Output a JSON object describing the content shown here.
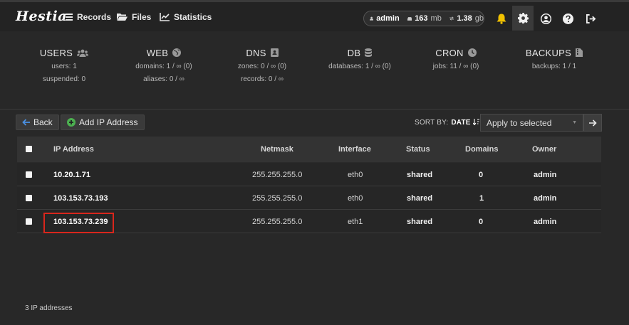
{
  "app": {
    "logo_text": "Hestia"
  },
  "nav": {
    "records": "Records",
    "files": "Files",
    "statistics": "Statistics"
  },
  "user_panel": {
    "username": "admin",
    "disk_value": "163",
    "disk_unit": "mb",
    "bandwidth_value": "1.38",
    "bandwidth_unit": "gb"
  },
  "stats": {
    "users": {
      "title": "USERS",
      "line1": "users: 1",
      "line2": "suspended: 0"
    },
    "web": {
      "title": "WEB",
      "line1": "domains: 1 / ∞ (0)",
      "line2": "aliases: 0 / ∞"
    },
    "dns": {
      "title": "DNS",
      "line1": "zones: 0 / ∞ (0)",
      "line2": "records: 0 / ∞"
    },
    "db": {
      "title": "DB",
      "line1": "databases: 1 / ∞ (0)"
    },
    "cron": {
      "title": "CRON",
      "line1": "jobs: 11 / ∞ (0)"
    },
    "backups": {
      "title": "BACKUPS",
      "line1": "backups: 1 / 1"
    }
  },
  "toolbar": {
    "back_label": "Back",
    "add_label": "Add IP Address",
    "sort_by_label": "SORT BY:",
    "sort_by_value": "DATE",
    "bulk_action_value": "Apply to selected"
  },
  "table": {
    "headers": {
      "ip": "IP Address",
      "netmask": "Netmask",
      "interface": "Interface",
      "status": "Status",
      "domains": "Domains",
      "owner": "Owner"
    },
    "rows": [
      {
        "ip": "10.20.1.71",
        "netmask": "255.255.255.0",
        "interface": "eth0",
        "status": "shared",
        "domains": "0",
        "owner": "admin"
      },
      {
        "ip": "103.153.73.193",
        "netmask": "255.255.255.0",
        "interface": "eth0",
        "status": "shared",
        "domains": "1",
        "owner": "admin"
      },
      {
        "ip": "103.153.73.239",
        "netmask": "255.255.255.0",
        "interface": "eth1",
        "status": "shared",
        "domains": "0",
        "owner": "admin"
      }
    ]
  },
  "footer": {
    "count_text": "3 IP addresses"
  },
  "colors": {
    "accent_blue": "#4a90e2",
    "add_green": "#4caf50",
    "bell_yellow": "#f2c200",
    "highlight_red": "#d9261c"
  }
}
